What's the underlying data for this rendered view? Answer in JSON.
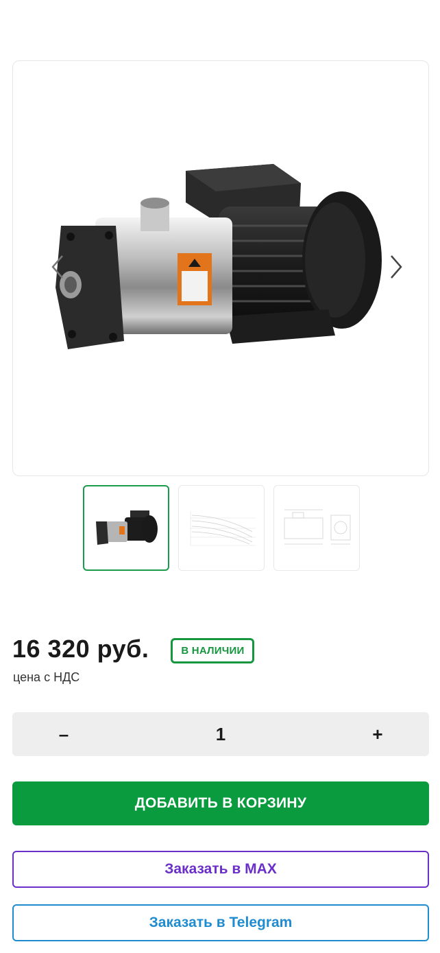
{
  "gallery": {
    "main_image": "pump-photo",
    "prev_icon": "chevron-left-icon",
    "next_icon": "chevron-right-icon",
    "thumbnails": [
      {
        "name": "pump-photo-thumb",
        "active": true
      },
      {
        "name": "performance-curve-thumb",
        "active": false
      },
      {
        "name": "dimension-drawing-thumb",
        "active": false
      }
    ]
  },
  "product": {
    "price": "16 320 руб.",
    "stock_badge": "В НАЛИЧИИ",
    "vat_note": "цена с НДС"
  },
  "quantity": {
    "minus_label": "–",
    "value": "1",
    "plus_label": "+"
  },
  "actions": {
    "add_to_cart": "ДОБАВИТЬ В КОРЗИНУ",
    "order_max": "Заказать в MAX",
    "order_telegram": "Заказать в Telegram"
  },
  "colors": {
    "accent_green": "#0a9b3f",
    "badge_green": "#16963f",
    "max_purple": "#6a2fc9",
    "telegram_blue": "#1f8ccf"
  }
}
